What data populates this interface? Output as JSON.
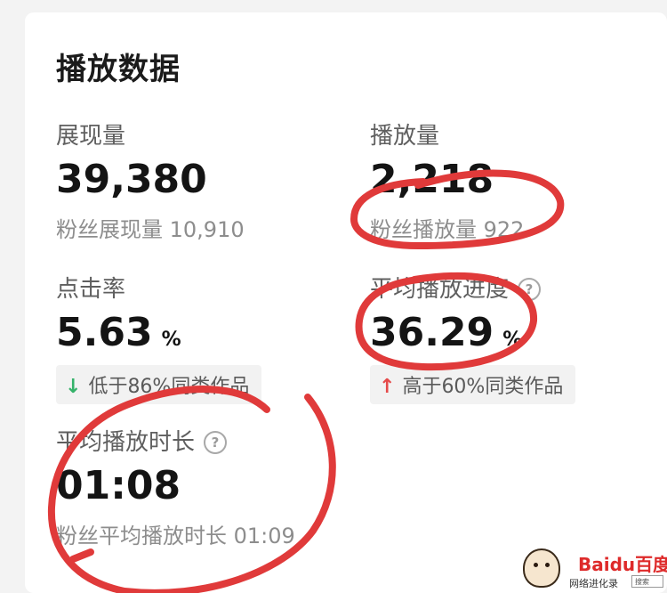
{
  "title": "播放数据",
  "metrics": {
    "impressions": {
      "label": "展现量",
      "value": "39,380",
      "sub_label": "粉丝展现量",
      "sub_value": "10,910"
    },
    "plays": {
      "label": "播放量",
      "value": "2,218",
      "sub_label": "粉丝播放量",
      "sub_value": "922"
    },
    "ctr": {
      "label": "点击率",
      "value": "5.63",
      "unit": "%",
      "compare_text": "低于86%同类作品",
      "compare_direction": "down"
    },
    "avg_progress": {
      "label": "平均播放进度",
      "value": "36.29",
      "unit": "%",
      "compare_text": "高于60%同类作品",
      "compare_direction": "up"
    },
    "avg_duration": {
      "label": "平均播放时长",
      "value": "01:08",
      "sub_label": "粉丝平均播放时长",
      "sub_value": "01:09"
    }
  },
  "icons": {
    "help": "?",
    "arrow_down": "↓",
    "arrow_up": "↑"
  },
  "colors": {
    "annotation": "#e03a3a",
    "compare_down": "#35b26a",
    "compare_up": "#e54a4a",
    "value_text": "#141414",
    "label_text": "#5f5f5f"
  },
  "watermark": {
    "brand": "Baidu百度",
    "tag": "网络进化录",
    "search": "搜索"
  }
}
